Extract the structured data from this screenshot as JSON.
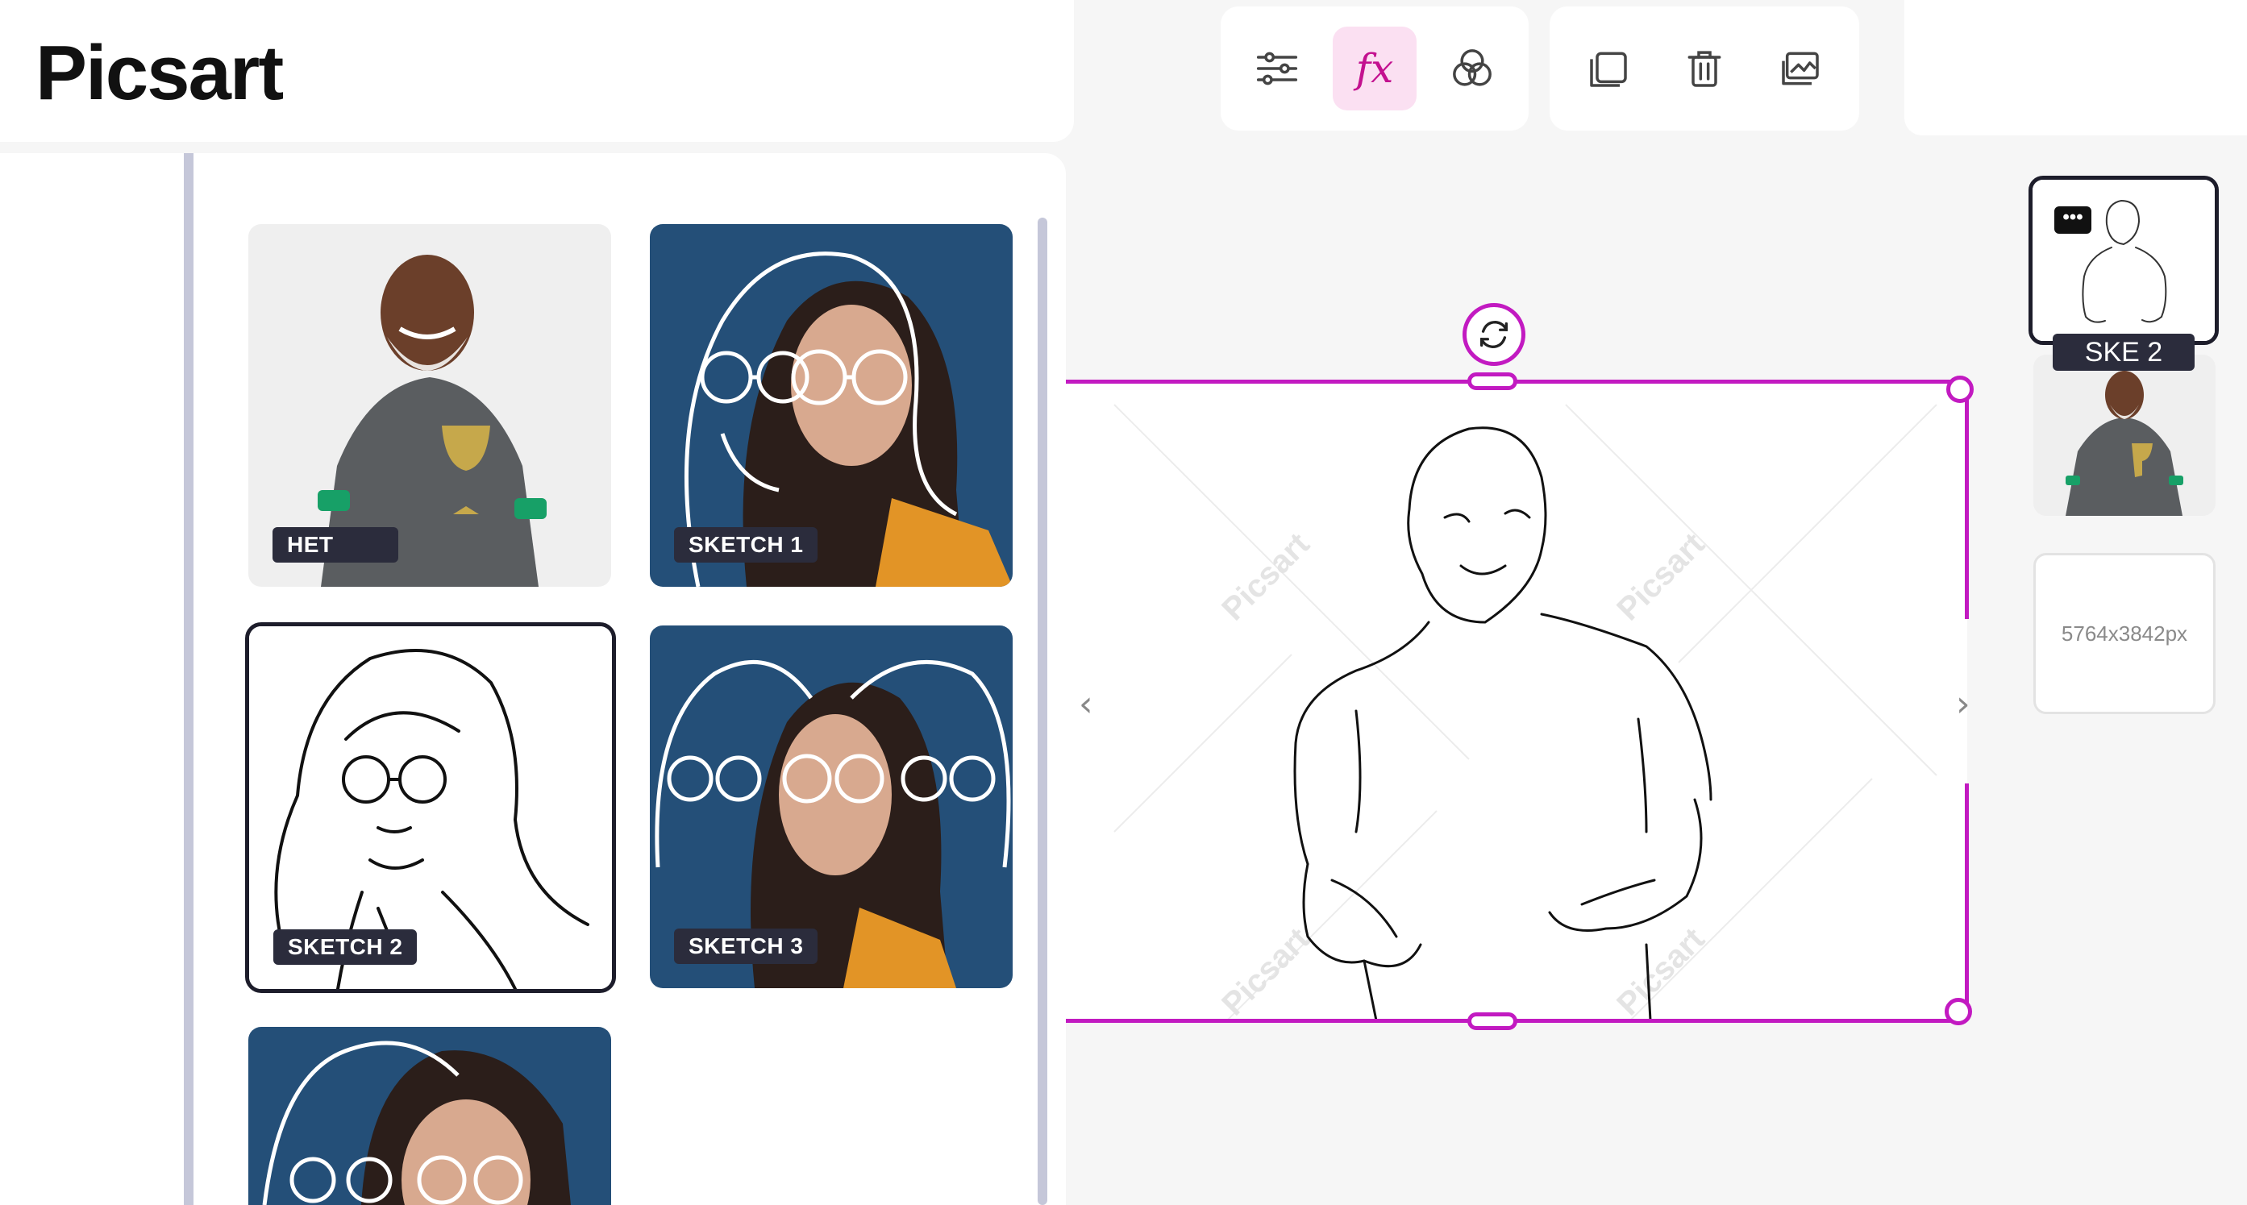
{
  "header": {
    "logo_text": "Picsart"
  },
  "toolbar": {
    "adjust_icon": "sliders-icon",
    "effects_label": "fx",
    "blend_icon": "blend-circles-icon",
    "duplicate_icon": "duplicate-icon",
    "delete_icon": "trash-icon",
    "replace_icon": "replace-image-icon"
  },
  "effects": [
    {
      "label": "HET"
    },
    {
      "label": "SKETCH 1"
    },
    {
      "label": "SKETCH 2",
      "selected": true
    },
    {
      "label": "SKETCH 3"
    },
    {
      "label": ""
    }
  ],
  "canvas": {
    "watermark": "Picsart",
    "prev_arrow": "‹",
    "next_arrow": "›"
  },
  "layers": {
    "more_label": "•••",
    "selected_label": "SKE 2",
    "size_text": "5764x3842px"
  },
  "colors": {
    "accent": "#c21ac1",
    "label_bg": "#2b2c3c",
    "active_tool_bg": "#fbe0f2"
  }
}
